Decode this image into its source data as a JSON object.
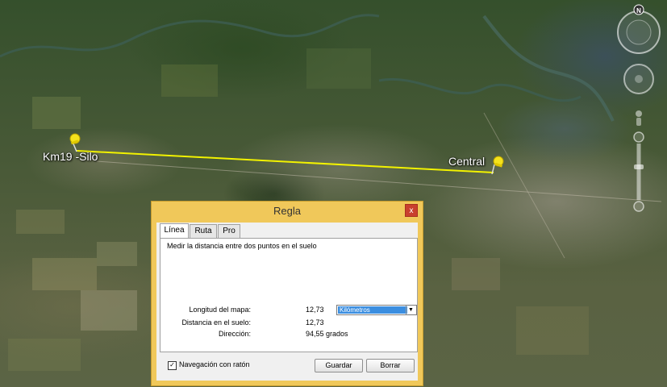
{
  "map": {
    "placemarks": [
      {
        "label": "Km19 -Silo",
        "icon": "yellow-pushpin-icon"
      },
      {
        "label": "Central",
        "icon": "yellow-pushpin-icon"
      }
    ],
    "ruler_line_color": "#f2f200",
    "compass_label": "N"
  },
  "dialog": {
    "title": "Regla",
    "close_label": "x",
    "tabs": [
      {
        "label": "Línea",
        "active": true
      },
      {
        "label": "Ruta",
        "active": false
      },
      {
        "label": "Pro",
        "active": false
      }
    ],
    "description": "Medir la distancia entre dos puntos en el suelo",
    "map_length_label": "Longitud del mapa:",
    "map_length_value": "12,73",
    "unit_selected": "Kilómetros",
    "ground_distance_label": "Distancia en el suelo:",
    "ground_distance_value": "12,73",
    "heading_label": "Dirección:",
    "heading_value": "94,55 grados",
    "mouse_nav_label": "Navegación con ratón",
    "mouse_nav_checked": true,
    "save_label": "Guardar",
    "clear_label": "Borrar"
  },
  "colors": {
    "dialog_frame": "#f0c85a",
    "close_button": "#c9402e",
    "selection": "#3b8ee0"
  }
}
